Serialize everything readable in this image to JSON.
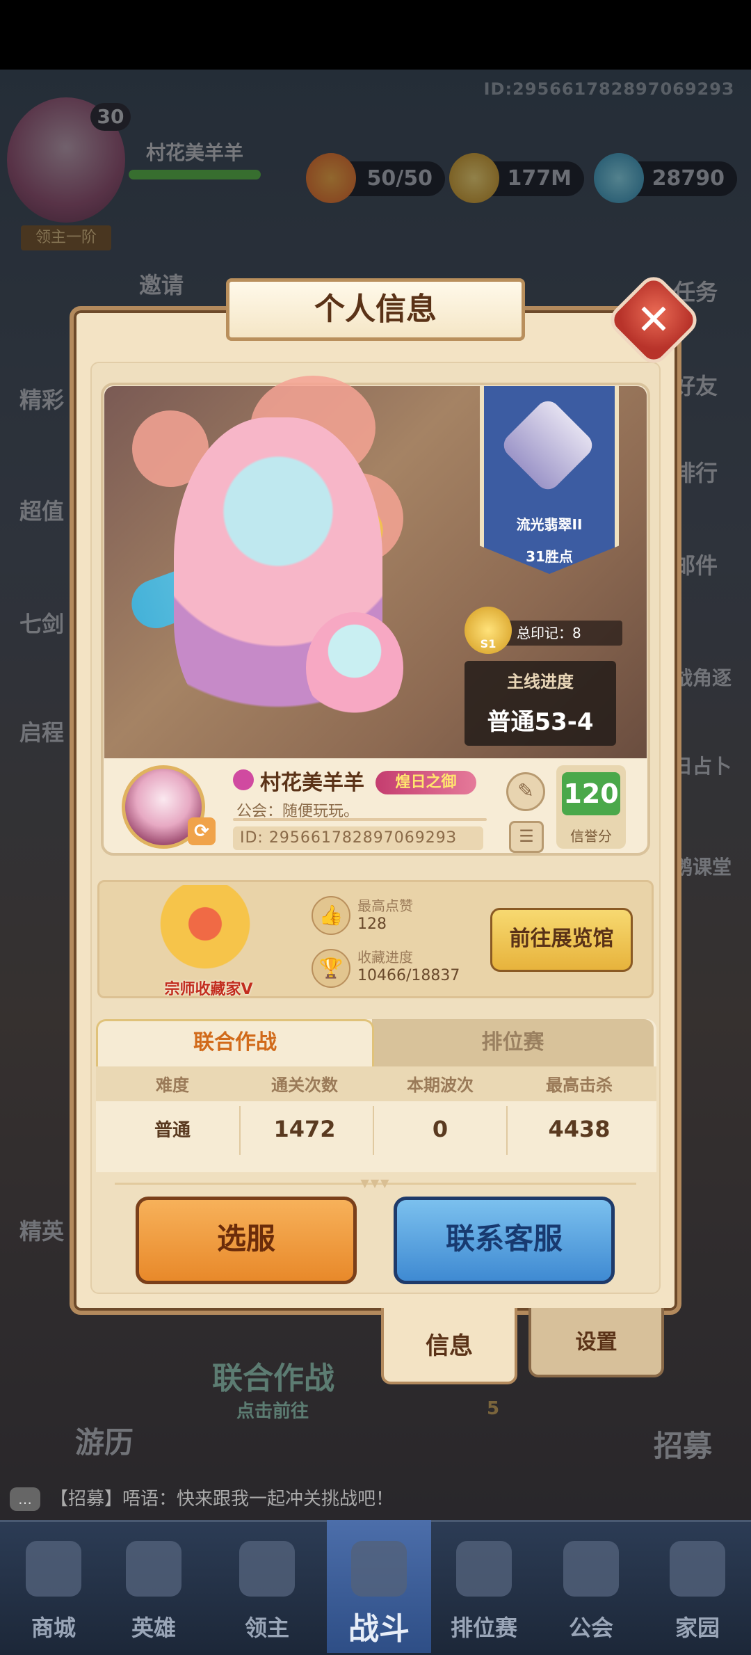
{
  "top": {
    "id_text": "ID:29566178289706929З",
    "player_level": "30",
    "player_name": "村花美羊羊",
    "lord_rank": "领主一阶",
    "energy": "50/50",
    "gold": "177M",
    "gems": "28790"
  },
  "side_left": [
    "邀请",
    "精彩",
    "超值",
    "七剑",
    "启程",
    "精英"
  ],
  "side_right": [
    "任务",
    "好友",
    "排行",
    "邮件",
    "战角逐",
    "日占卜",
    "鹅课堂",
    "招募"
  ],
  "bg_buttons": {
    "coop": "联合作战",
    "coop_sub": "点击前往",
    "travel": "游历",
    "recruit_sub": "5"
  },
  "modal": {
    "title": "个人信息",
    "rank": {
      "name": "流光翡翠II",
      "points": "31胜点"
    },
    "marks": {
      "label": "总印记：",
      "value": "8",
      "season": "S1"
    },
    "mainline": {
      "label": "主线进度",
      "value": "普通53-4"
    },
    "player": {
      "name": "村花美羊羊",
      "title_tag": "煌日之御",
      "guild": "公会：随便玩玩。",
      "id": "ID: 29566178289706929З",
      "credit_value": "120",
      "credit_label": "信誉分"
    },
    "collection": {
      "title": "宗师收藏家V",
      "likes_label": "最高点赞",
      "likes_value": "128",
      "progress_label": "收藏进度",
      "progress_value": "10466/18837",
      "gallery_button": "前往展览馆"
    },
    "tabs": [
      "联合作战",
      "排位赛"
    ],
    "table": {
      "headers": [
        "难度",
        "通关次数",
        "本期波次",
        "最高击杀"
      ],
      "row": [
        "普通",
        "1472",
        "0",
        "4438"
      ]
    },
    "buttons": {
      "select_server": "选服",
      "contact_support": "联系客服"
    },
    "bottom_tabs": {
      "info": "信息",
      "settings": "设置"
    }
  },
  "chat": {
    "text": "【招募】唔语：快来跟我一起冲关挑战吧！"
  },
  "nav": [
    {
      "label": "商城",
      "active": false
    },
    {
      "label": "英雄",
      "active": false
    },
    {
      "label": "领主",
      "active": false
    },
    {
      "label": "战斗",
      "active": true
    },
    {
      "label": "排位赛",
      "active": false
    },
    {
      "label": "公会",
      "active": false
    },
    {
      "label": "家园",
      "active": false
    }
  ],
  "colors": {
    "accent_orange": "#e8892a",
    "accent_blue": "#3f8ad2",
    "credit_green": "#4aa84a",
    "close_red": "#b8332a"
  }
}
